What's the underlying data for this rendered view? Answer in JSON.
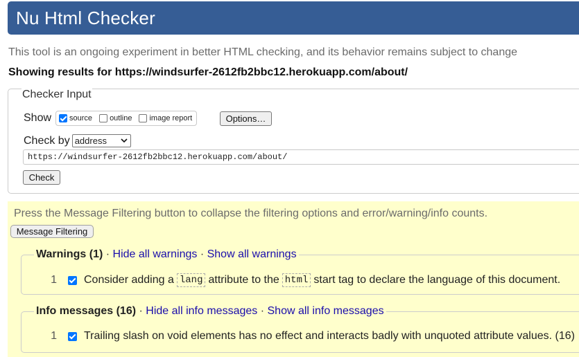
{
  "header": {
    "title": "Nu Html Checker"
  },
  "intro": "This tool is an ongoing experiment in better HTML checking, and its behavior remains subject to change",
  "showing": "Showing results for https://windsurfer-2612fb2bbc12.herokuapp.com/about/",
  "checker_input": {
    "legend": "Checker Input",
    "show_label": "Show",
    "show_options": [
      {
        "label": "source",
        "checked": true
      },
      {
        "label": "outline",
        "checked": false
      },
      {
        "label": "image report",
        "checked": false
      }
    ],
    "options_button": "Options…",
    "check_by_label": "Check by",
    "check_by_value": "address",
    "url_value": "https://windsurfer-2612fb2bbc12.herokuapp.com/about/",
    "check_button": "Check"
  },
  "filtering": {
    "hint": "Press the Message Filtering button to collapse the filtering options and error/warning/info counts.",
    "button": "Message Filtering"
  },
  "warnings": {
    "title": "Warnings (1)",
    "sep": "·",
    "hide": "Hide all warnings",
    "show": "Show all warnings",
    "item": {
      "num": "1",
      "checked": true,
      "text_a": "Consider adding a",
      "code_a": "lang",
      "text_b": "attribute to the",
      "code_b": "html",
      "text_c": "start tag to declare the language of this document."
    }
  },
  "info": {
    "title": "Info messages (16)",
    "sep": "·",
    "hide": "Hide all info messages",
    "show": "Show all info messages",
    "item": {
      "num": "1",
      "checked": true,
      "text": "Trailing slash on void elements has no effect and interacts badly with unquoted attribute values. (16)"
    }
  },
  "colors": {
    "header_bg": "#365d95",
    "filter_bg": "#ffffcc",
    "link": "#1a0dab",
    "checkbox": "#0075ff"
  }
}
